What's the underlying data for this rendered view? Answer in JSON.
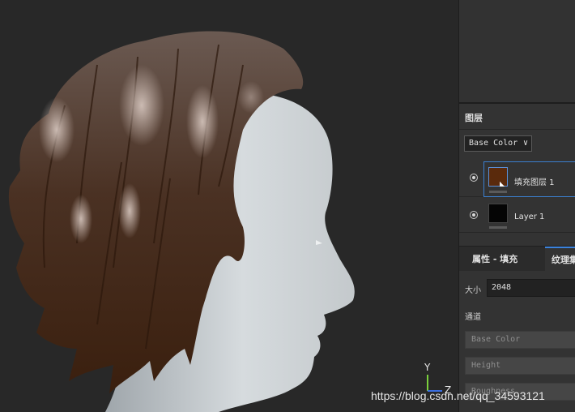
{
  "viewport": {
    "axis": {
      "y_label": "Y",
      "z_label": "Z"
    }
  },
  "layers_panel": {
    "title": "图层",
    "channel_select": {
      "value": "Base Color"
    },
    "layers": [
      {
        "name": "填充图层 1",
        "thumb_color": "#5a2a0c",
        "selected": true
      },
      {
        "name": "Layer 1",
        "thumb_color": "#050505",
        "selected": false
      }
    ]
  },
  "properties": {
    "tabs": [
      {
        "label": "属性 - 填充"
      },
      {
        "label": "纹理集"
      }
    ],
    "size_label": "大小",
    "size_value": "2048",
    "channels_label": "通道",
    "channels": [
      "Base Color",
      "Height",
      "Roughness"
    ]
  },
  "watermark": "https://blog.csdn.net/qq_34593121",
  "colors": {
    "accent": "#3b82dc",
    "panel_bg": "#333333",
    "viewport_bg": "#282828",
    "hair": "#4a3020",
    "skin": "#cfd4d7"
  }
}
